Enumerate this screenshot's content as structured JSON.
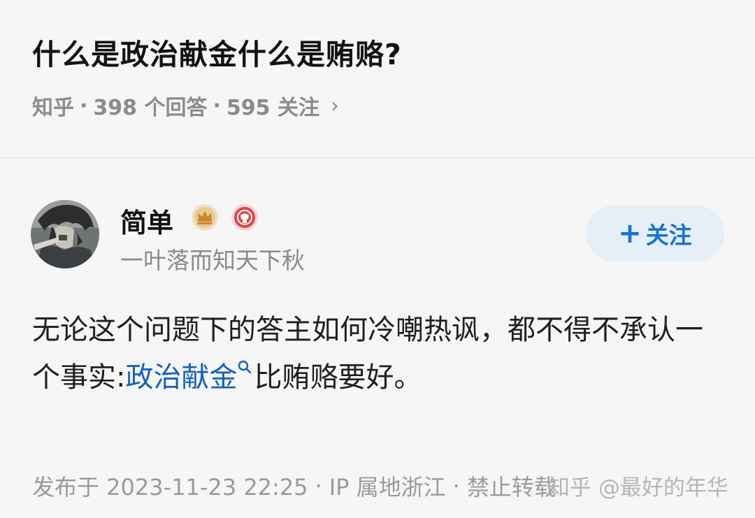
{
  "question": {
    "title": "什么是政治献金什么是贿赂?",
    "meta": {
      "source": "知乎",
      "answers": "398 个回答",
      "followers": "595 关注",
      "separator": "·",
      "chevron": "›"
    }
  },
  "author": {
    "name": "简单",
    "bio": "一叶落而知天下秋",
    "badges": [
      "crown-badge-icon",
      "red-badge-icon"
    ],
    "follow_plus": "+",
    "follow_label": "关注"
  },
  "answer": {
    "text_before": "无论这个问题下的答主如何冷嘲热讽，都不得不承认一个事实:",
    "keyword": "政治献金",
    "text_after": "比贿赂要好。"
  },
  "footer": {
    "published": "发布于 2023-11-23 22:25",
    "separator": "·",
    "ip": "IP 属地浙江",
    "repost": "禁止转载"
  },
  "watermark": "知乎 @最好的年华",
  "colors": {
    "accent": "#1772d6",
    "link": "#1760b8",
    "follow_bg": "#e6eef7",
    "muted": "#8b8b8b",
    "background": "#f6f6f6"
  }
}
